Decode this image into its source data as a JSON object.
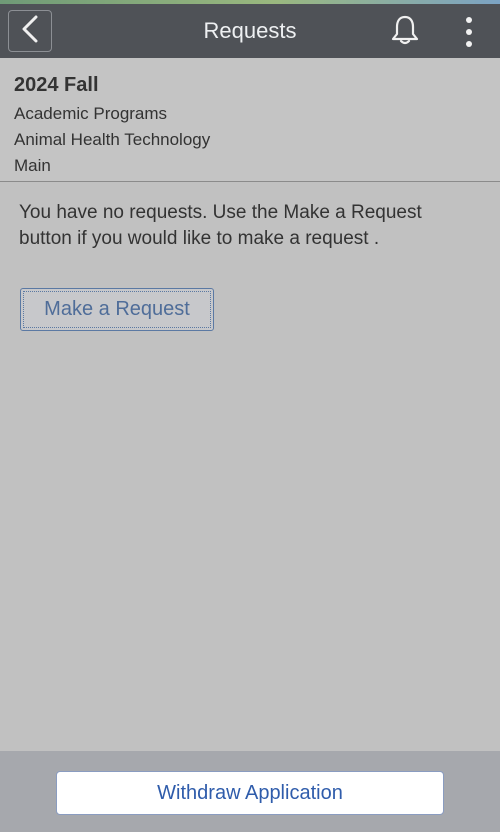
{
  "header": {
    "title": "Requests",
    "back_icon": "chevron-left-icon",
    "notification_icon": "bell-icon",
    "menu_icon": "more-vertical-icon"
  },
  "context": {
    "term": "2024 Fall",
    "career": "Academic Programs",
    "program": "Animal Health Technology",
    "campus": "Main"
  },
  "main": {
    "message": "You have no requests. Use the Make a Request button if you would like to make a request .",
    "make_request_label": "Make a Request"
  },
  "footer": {
    "withdraw_label": "Withdraw Application"
  },
  "colors": {
    "header_bg": "#4f5257",
    "page_bg": "#c1c1c1",
    "link_blue": "#2f5cab"
  }
}
